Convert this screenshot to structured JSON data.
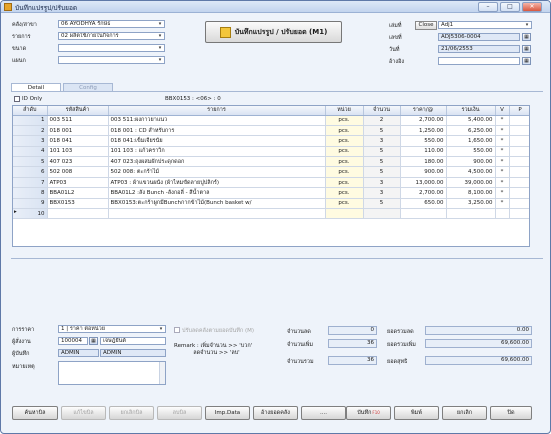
{
  "window": {
    "title": "บันทึกแปรรูป/ปรับยอด",
    "minimize": "–",
    "maximize": "□",
    "close": "✕"
  },
  "header": {
    "warehouse_label": "คลัง/สาขา",
    "warehouse_value": "06  AYODHYA รักษ์ธ",
    "item_label": "รายการ",
    "item_value": "02  ผลิตใช้ภายในกิจการ",
    "project_label": "ขนาด",
    "project_value": "",
    "dept_label": "แผนก",
    "dept_value": "",
    "main_button": "บันทึกแปรรูป / ปรับยอด (M1)",
    "book_label": "เล่มที่",
    "close_button": "Close",
    "book_value": "Adj1",
    "docno_label": "เลขที่",
    "docno_value": "ADJ5306-0004",
    "date_label": "วันที่",
    "date_value": "21/06/2553",
    "ref_label": "อ้างอิง",
    "ref_value": ""
  },
  "tabs": [
    "Detail",
    "Config"
  ],
  "id_only_label": "ID Only",
  "bbx_info": "BBX0153 : <06> : 0",
  "table": {
    "columns": [
      "ลำดับ",
      "รหัสสินค้า",
      "รายการ",
      "หน่วย",
      "จำนวน",
      "ราคา/@",
      "รวมเงิน",
      "V",
      "P"
    ],
    "rows": [
      [
        "1",
        "003 511",
        "003 511:ผงกาวยาแนว",
        "pcs.",
        "2",
        "2,700.00",
        "5,400.00",
        "*",
        ""
      ],
      [
        "2",
        "018 001",
        "018 001 : CD สำหรับการ",
        "pcs.",
        "5",
        "1,250.00",
        "6,250.00",
        "*",
        ""
      ],
      [
        "3",
        "018 041",
        "018 041:เข็มเจียรนัย",
        "pcs.",
        "3",
        "550.00",
        "1,650.00",
        "*",
        ""
      ],
      [
        "4",
        "101 103",
        "101 103 : แก้วคราวิก",
        "pcs.",
        "5",
        "110.00",
        "550.00",
        "*",
        ""
      ],
      [
        "5",
        "407 023",
        "407 023:ถุงผสมผักประดุกดอก",
        "pcs.",
        "5",
        "180.00",
        "900.00",
        "*",
        ""
      ],
      [
        "6",
        "502 008",
        "502 008: ตะกร้าไม้",
        "pcs.",
        "5",
        "900.00",
        "4,500.00",
        "*",
        ""
      ],
      [
        "7",
        "ATP03",
        "ATP03 : ผ้าแขวนผนัง (ผ้าไหมขัดลายปูปลิกร์)",
        "pcs.",
        "3",
        "13,000.00",
        "39,000.00",
        "*",
        ""
      ],
      [
        "8",
        "BBA01L2",
        "BBA01L2 :ลัง Bunch -ลังกอลี่ - สีน้ำตาล",
        "pcs.",
        "3",
        "2,700.00",
        "8,100.00",
        "*",
        ""
      ],
      [
        "9",
        "BBX0153",
        "BBX0153:ตะกร้าผูกมีBunchกากข้าไม้(Bunch basket w/",
        "pcs.",
        "5",
        "650.00",
        "3,250.00",
        "*",
        ""
      ],
      [
        "10",
        "",
        "",
        "",
        "",
        "",
        "",
        "",
        ""
      ]
    ]
  },
  "footer": {
    "cost_label": "การราคา",
    "cost_value": "1  | ราคา ต่อหน่วย",
    "recorder_label": "ผู้สั่งงาน",
    "recorder_code": "100004",
    "recorder_name": "เจษฎ์ยันต์",
    "approver_label": "ผู้บันทึก",
    "approver_code": "ADMIN",
    "approver_name": "ADMIN",
    "memo_label": "หมายเหตุ",
    "checkbox_label": "ปรับลดคลังตามยอดบันทึก (M)",
    "remark": "Remark : เพิ่มจำนวน >> 'บวก'\n           ลดจำนวน >> 'ลบ'",
    "qty_decrease_label": "จำนวนลด",
    "qty_decrease": "0",
    "qty_increase_label": "จำนวนเพิ่ม",
    "qty_increase": "36",
    "qty_total_label": "จำนวนรวม",
    "qty_total": "36",
    "amt_decrease_label": "ยอดรวมลด",
    "amt_decrease": "0.00",
    "amt_increase_label": "ยอดรวมเพิ่ม",
    "amt_increase": "69,600.00",
    "amt_net_label": "ยอดสุทธิ",
    "amt_net": "69,600.00"
  },
  "buttons": {
    "search": "ค้นหาบิล",
    "edit": "แก้ไขบิล",
    "cancel_bill": "ยกเลิกบิล",
    "delete": "ลบบิล",
    "import": "Imp.Data",
    "ref_bill": "อ้างยอดคลัง",
    "more": "....",
    "save": "บันทึก",
    "save_key": "F10",
    "print": "พิมพ์",
    "cancel": "ยกเลิก",
    "close": "ปิด"
  }
}
